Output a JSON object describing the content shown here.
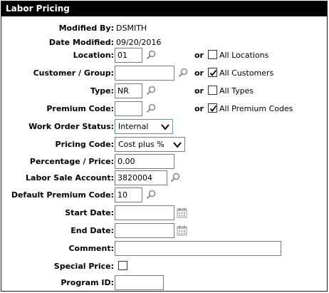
{
  "title": "Labor Pricing",
  "fields": {
    "modified_by": {
      "label": "Modified By:",
      "value": "DSMITH"
    },
    "date_modified": {
      "label": "Date Modified:",
      "value": "09/20/2016"
    },
    "location": {
      "label": "Location:",
      "value": "01",
      "or": "or",
      "all_label": "All Locations",
      "all_checked": false
    },
    "customer_group": {
      "label": "Customer / Group:",
      "value": "",
      "or": "or",
      "all_label": "All Customers",
      "all_checked": true
    },
    "type": {
      "label": "Type:",
      "value": "NR",
      "or": "or",
      "all_label": "All Types",
      "all_checked": false
    },
    "premium_code": {
      "label": "Premium Code:",
      "value": "",
      "or": "or",
      "all_label": "All Premium Codes",
      "all_checked": true
    },
    "work_order_status": {
      "label": "Work Order Status:",
      "value": "Internal"
    },
    "pricing_code": {
      "label": "Pricing Code:",
      "value": "Cost plus %"
    },
    "percentage_price": {
      "label": "Percentage / Price:",
      "value": "0.00"
    },
    "labor_sale_account": {
      "label": "Labor Sale Account:",
      "value": "3820004"
    },
    "default_premium_code": {
      "label": "Default Premium Code:",
      "value": "10"
    },
    "start_date": {
      "label": "Start Date:",
      "value": ""
    },
    "end_date": {
      "label": "End Date:",
      "value": ""
    },
    "comment": {
      "label": "Comment:",
      "value": ""
    },
    "special_price": {
      "label": "Special Price:",
      "checked": false
    },
    "program_id": {
      "label": "Program ID:",
      "value": ""
    }
  },
  "icons": {
    "lookup": "magnifier-icon",
    "calendar": "calendar-icon",
    "dropdown": "chevron-down-icon",
    "check": "checkmark-icon"
  }
}
